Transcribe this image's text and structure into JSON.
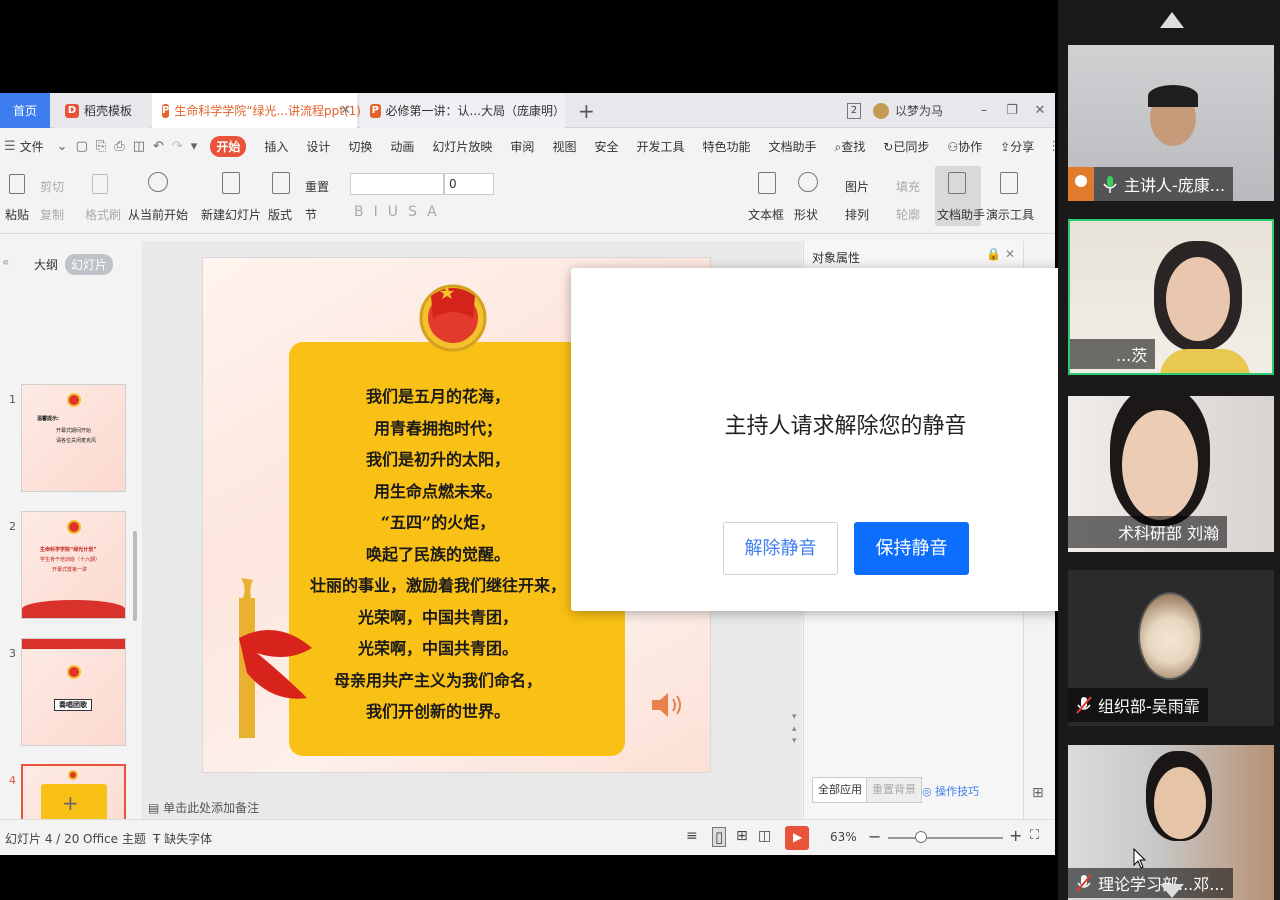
{
  "tabs": {
    "home": "首页",
    "templates": "稻壳模板",
    "doc1": "生命科学学院“绿光...讲流程ppt(1)",
    "doc2": "必修第一讲：认...大局（庞康明）",
    "window_count": "2",
    "user": "以梦为马"
  },
  "menu": {
    "file": "文件",
    "items": [
      "开始",
      "插入",
      "设计",
      "切换",
      "动画",
      "幻灯片放映",
      "审阅",
      "视图",
      "安全",
      "开发工具",
      "特色功能",
      "文档助手"
    ],
    "search": "查找",
    "sync": "已同步",
    "collab": "协作",
    "share": "分享"
  },
  "ribbon": {
    "paste": "粘贴",
    "cut": "剪切",
    "copy": "复制",
    "format_painter": "格式刷",
    "from_current": "从当前开始",
    "new_slide": "新建幻灯片",
    "layout": "版式",
    "reset": "重置",
    "section": "节",
    "font_size": "0",
    "textbox": "文本框",
    "shape": "形状",
    "arrange": "排列",
    "picture": "图片",
    "fill": "填充",
    "outline": "轮廓",
    "doc_helper": "文档助手",
    "present_tools": "演示工具"
  },
  "left_panel": {
    "outline_tab": "大纲",
    "slides_tab": "幻灯片",
    "thumbs": [
      {
        "num": "1",
        "title": "温馨提示:",
        "lines": [
          "开幕式期间开始",
          "请各位关闭麦克风"
        ]
      },
      {
        "num": "2",
        "title": "生命科学学院“绿光计划”",
        "lines": [
          "学生骨干培训班（十六期）",
          "开幕式暨第一讲"
        ]
      },
      {
        "num": "3",
        "title": "奏唱团歌",
        "lines": []
      },
      {
        "num": "4",
        "title": "",
        "lines": []
      }
    ]
  },
  "slide": {
    "poem": [
      "我们是五月的花海，",
      "用青春拥抱时代；",
      "我们是初升的太阳，",
      "用生命点燃未来。",
      "“五四”的火炬，",
      "唤起了民族的觉醒。",
      "壮丽的事业，激励着我们继往开来，",
      "光荣啊，中国共青团，",
      "光荣啊，中国共青团。",
      "母亲用共产主义为我们命名，",
      "我们开创新的世界。"
    ],
    "emblem_text": "中国共青团"
  },
  "notes_placeholder": "单击此处添加备注",
  "props": {
    "title": "对象属性",
    "apply_all": "全部应用",
    "reset_bg": "重置背景",
    "tips": "操作技巧"
  },
  "status": {
    "slide_count": "幻灯片 4 / 20",
    "theme": "Office 主题",
    "missing_font": "缺失字体",
    "zoom": "63%"
  },
  "dialog": {
    "message": "主持人请求解除您的静音",
    "unmute": "解除静音",
    "keep_muted": "保持静音"
  },
  "participants": [
    {
      "name": "主讲人-庞康...",
      "mic": "on"
    },
    {
      "name": "...茨",
      "mic": "on"
    },
    {
      "name": "术科研部 刘瀚",
      "mic": "on"
    },
    {
      "name": "组织部-吴雨霏",
      "mic": "off"
    },
    {
      "name": "理论学习部...邓...",
      "mic": "off"
    }
  ],
  "colors": {
    "accent": "#e9533a",
    "blue": "#0d6efd",
    "active_border": "#2ecc71"
  }
}
